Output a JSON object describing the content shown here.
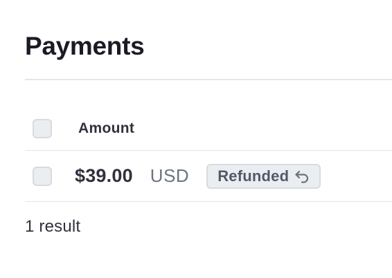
{
  "page": {
    "title": "Payments"
  },
  "table": {
    "columns": [
      "Amount"
    ],
    "rows": [
      {
        "amount": "$39.00",
        "currency": "USD",
        "status": "Refunded",
        "status_icon": "refund-arrow-icon",
        "selected": false
      }
    ]
  },
  "footer": {
    "result_count": "1 result"
  },
  "colors": {
    "text_primary": "#30313d",
    "text_secondary": "#6a7383",
    "badge_background": "#ebeef1",
    "badge_border": "#d5dbe1",
    "divider": "#e3e5e8"
  }
}
